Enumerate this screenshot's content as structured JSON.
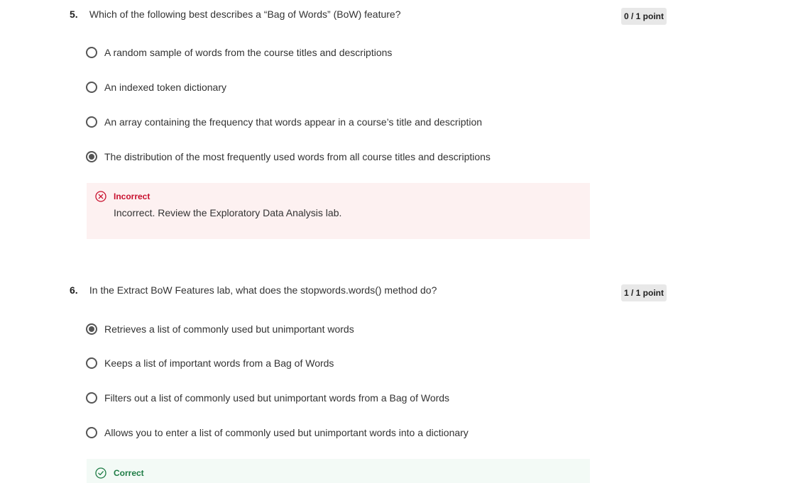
{
  "questions": [
    {
      "number": "5.",
      "text": "Which of the following best describes a “Bag of Words” (BoW) feature?",
      "points": "0 / 1 point",
      "options": [
        {
          "label": "A random sample of words from the course titles and descriptions",
          "selected": false
        },
        {
          "label": "An indexed token dictionary",
          "selected": false
        },
        {
          "label": "An array containing the frequency that words appear in a course’s title and description",
          "selected": false
        },
        {
          "label": "The distribution of the most frequently used words from all course titles and descriptions",
          "selected": true
        }
      ],
      "feedback": {
        "status": "Incorrect",
        "text": "Incorrect. Review the Exploratory Data Analysis lab.",
        "icon": "x-circle-icon",
        "color": "#c8102e"
      }
    },
    {
      "number": "6.",
      "text": "In the Extract BoW Features lab, what does the stopwords.words() method do?",
      "points": "1 / 1 point",
      "options": [
        {
          "label": "Retrieves a list of commonly used but unimportant words",
          "selected": true
        },
        {
          "label": "Keeps a list of important words from a Bag of Words",
          "selected": false
        },
        {
          "label": "Filters out a list of commonly used but unimportant words from a Bag of Words",
          "selected": false
        },
        {
          "label": "Allows you to enter a list of commonly used but unimportant words into a dictionary",
          "selected": false
        }
      ],
      "feedback": {
        "status": "Correct",
        "text": "",
        "icon": "check-circle-icon",
        "color": "#1e7c45"
      }
    }
  ]
}
